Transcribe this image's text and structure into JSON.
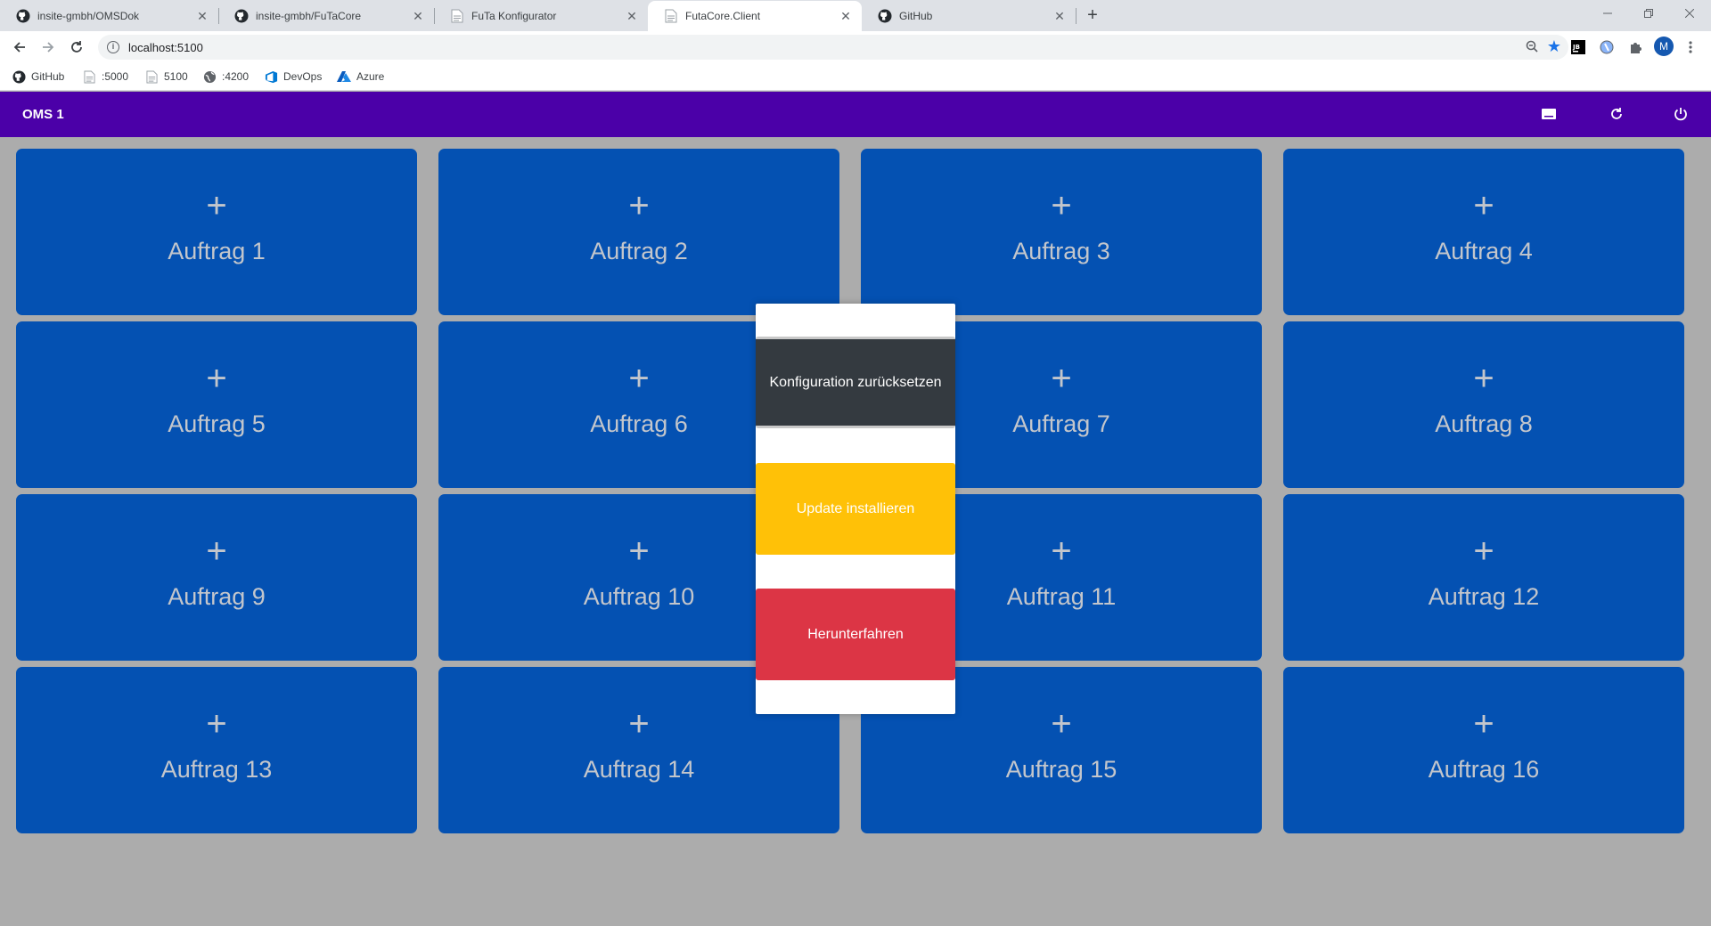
{
  "browser": {
    "tabs": [
      {
        "title": "insite-gmbh/OMSDok",
        "icon": "github-icon",
        "active": false
      },
      {
        "title": "insite-gmbh/FuTaCore",
        "icon": "github-icon",
        "active": false
      },
      {
        "title": "FuTa Konfigurator",
        "icon": "page-icon",
        "active": false
      },
      {
        "title": "FutaCore.Client",
        "icon": "page-icon",
        "active": true
      },
      {
        "title": "GitHub",
        "icon": "github-icon",
        "active": false
      }
    ],
    "close_glyph": "✕",
    "new_tab_glyph": "+",
    "url": "localhost:5100",
    "profile_initial": "M",
    "bookmarks": [
      {
        "label": "GitHub",
        "icon": "github-icon"
      },
      {
        "label": ":5000",
        "icon": "page-icon"
      },
      {
        "label": "5100",
        "icon": "page-icon"
      },
      {
        "label": ":4200",
        "icon": "globe-icon"
      },
      {
        "label": "DevOps",
        "icon": "devops-icon"
      },
      {
        "label": "Azure",
        "icon": "azure-icon"
      }
    ]
  },
  "app": {
    "title": "OMS 1",
    "accent": "#4b00a8",
    "tile_color": "#0451b2",
    "plus_glyph": "+",
    "tiles": [
      "Auftrag 1",
      "Auftrag 2",
      "Auftrag 3",
      "Auftrag 4",
      "Auftrag 5",
      "Auftrag 6",
      "Auftrag 7",
      "Auftrag 8",
      "Auftrag 9",
      "Auftrag 10",
      "Auftrag 11",
      "Auftrag 12",
      "Auftrag 13",
      "Auftrag 14",
      "Auftrag 15",
      "Auftrag 16"
    ]
  },
  "dialog": {
    "reset_label": "Konfiguration zurücksetzen",
    "update_label": "Update installieren",
    "shutdown_label": "Herunterfahren",
    "colors": {
      "reset": "#343a40",
      "update": "#ffc107",
      "shutdown": "#dc3545"
    }
  }
}
